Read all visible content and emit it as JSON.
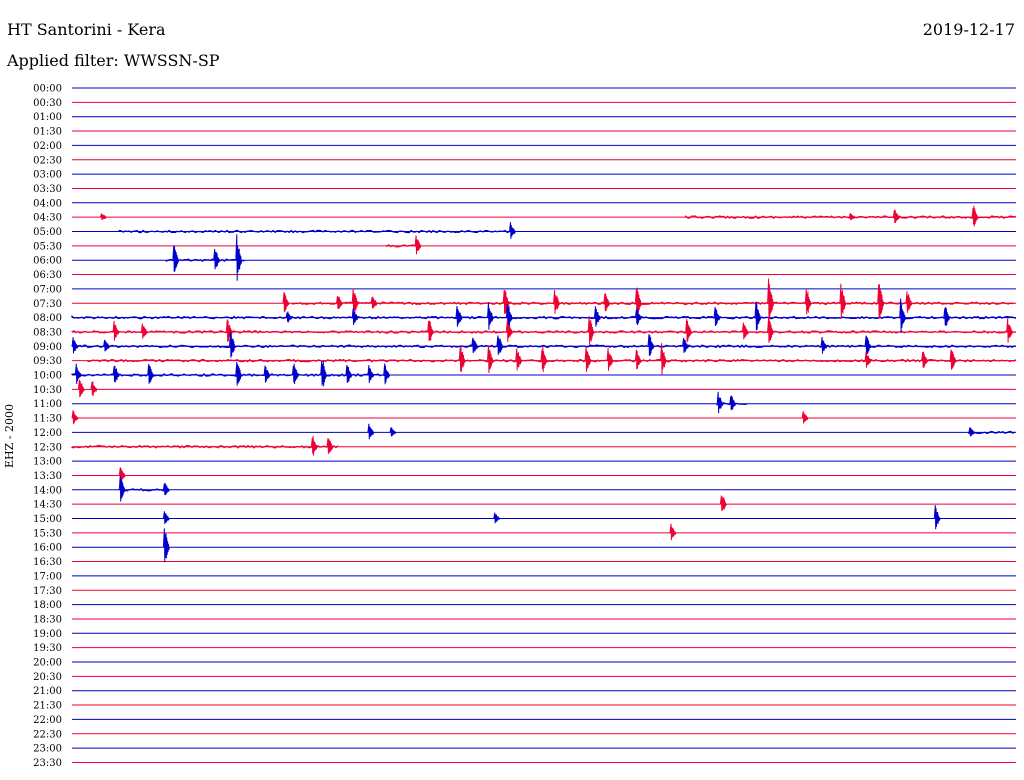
{
  "header": {
    "station": "HT Santorini - Kera",
    "date": "2019-12-17",
    "filter": "Applied filter: WWSSN-SP"
  },
  "chart_data": {
    "type": "line",
    "title": "HT Santorini - Kera",
    "subtitle": "Applied filter: WWSSN-SP",
    "ylabel": "EHZ - 2000",
    "xlabel": "",
    "grid": false,
    "legend": "none",
    "x_range_minutes": [
      0,
      30
    ],
    "colors": {
      "even": "#0000cc",
      "odd": "#ee0033"
    },
    "rows": [
      "00:00",
      "00:30",
      "01:00",
      "01:30",
      "02:00",
      "02:30",
      "03:00",
      "03:30",
      "04:00",
      "04:30",
      "05:00",
      "05:30",
      "06:00",
      "06:30",
      "07:00",
      "07:30",
      "08:00",
      "08:30",
      "09:00",
      "09:30",
      "10:00",
      "10:30",
      "11:00",
      "11:30",
      "12:00",
      "12:30",
      "13:00",
      "13:30",
      "14:00",
      "14:30",
      "15:00",
      "15:30",
      "16:00",
      "16:30",
      "17:00",
      "17:30",
      "18:00",
      "18:30",
      "19:00",
      "19:30",
      "20:00",
      "20:30",
      "21:00",
      "21:30",
      "22:00",
      "22:30",
      "23:00",
      "23:30"
    ],
    "segments": [
      {
        "row": "04:30",
        "start": 19.5,
        "end": 30.0
      },
      {
        "row": "05:00",
        "start": 1.5,
        "end": 14.0
      },
      {
        "row": "05:30",
        "start": 10.0,
        "end": 11.0
      },
      {
        "row": "06:00",
        "start": 3.0,
        "end": 5.5
      },
      {
        "row": "07:30",
        "start": 7.0,
        "end": 30.0
      },
      {
        "row": "08:00",
        "start": 0.0,
        "end": 30.0
      },
      {
        "row": "08:30",
        "start": 0.0,
        "end": 30.0
      },
      {
        "row": "09:00",
        "start": 0.0,
        "end": 30.0
      },
      {
        "row": "09:30",
        "start": 0.5,
        "end": 30.0
      },
      {
        "row": "10:00",
        "start": 0.0,
        "end": 10.0
      },
      {
        "row": "11:00",
        "start": 20.5,
        "end": 21.5
      },
      {
        "row": "12:00",
        "start": 28.5,
        "end": 30.0
      },
      {
        "row": "12:30",
        "start": 0.0,
        "end": 8.5
      },
      {
        "row": "14:00",
        "start": 1.5,
        "end": 3.0
      }
    ],
    "events": [
      {
        "row": "04:30",
        "t": 1.0,
        "amp": 5
      },
      {
        "row": "04:30",
        "t": 24.8,
        "amp": 4
      },
      {
        "row": "04:30",
        "t": 26.2,
        "amp": 10
      },
      {
        "row": "04:30",
        "t": 28.7,
        "amp": 14
      },
      {
        "row": "05:00",
        "t": 14.0,
        "amp": 10
      },
      {
        "row": "05:30",
        "t": 11.0,
        "amp": 12
      },
      {
        "row": "06:00",
        "t": 3.3,
        "amp": 18
      },
      {
        "row": "06:00",
        "t": 4.6,
        "amp": 14
      },
      {
        "row": "06:00",
        "t": 5.3,
        "amp": 26
      },
      {
        "row": "07:30",
        "t": 6.8,
        "amp": 12
      },
      {
        "row": "07:30",
        "t": 8.5,
        "amp": 10
      },
      {
        "row": "07:30",
        "t": 9.0,
        "amp": 16
      },
      {
        "row": "07:30",
        "t": 9.6,
        "amp": 10
      },
      {
        "row": "07:30",
        "t": 13.8,
        "amp": 18
      },
      {
        "row": "07:30",
        "t": 15.4,
        "amp": 16
      },
      {
        "row": "07:30",
        "t": 17.0,
        "amp": 12
      },
      {
        "row": "07:30",
        "t": 18.0,
        "amp": 20
      },
      {
        "row": "07:30",
        "t": 22.2,
        "amp": 26
      },
      {
        "row": "07:30",
        "t": 23.4,
        "amp": 18
      },
      {
        "row": "07:30",
        "t": 24.5,
        "amp": 22
      },
      {
        "row": "07:30",
        "t": 25.7,
        "amp": 26
      },
      {
        "row": "07:30",
        "t": 26.6,
        "amp": 14
      },
      {
        "row": "08:00",
        "t": 6.9,
        "amp": 8
      },
      {
        "row": "08:00",
        "t": 9.0,
        "amp": 10
      },
      {
        "row": "08:00",
        "t": 12.3,
        "amp": 16
      },
      {
        "row": "08:00",
        "t": 13.3,
        "amp": 16
      },
      {
        "row": "08:00",
        "t": 13.9,
        "amp": 18
      },
      {
        "row": "08:00",
        "t": 16.7,
        "amp": 12
      },
      {
        "row": "08:00",
        "t": 18.0,
        "amp": 12
      },
      {
        "row": "08:00",
        "t": 20.5,
        "amp": 12
      },
      {
        "row": "08:00",
        "t": 21.8,
        "amp": 18
      },
      {
        "row": "08:00",
        "t": 26.4,
        "amp": 20
      },
      {
        "row": "08:00",
        "t": 27.8,
        "amp": 14
      },
      {
        "row": "08:30",
        "t": 1.4,
        "amp": 12
      },
      {
        "row": "08:30",
        "t": 2.3,
        "amp": 10
      },
      {
        "row": "08:30",
        "t": 5.0,
        "amp": 14
      },
      {
        "row": "08:30",
        "t": 11.4,
        "amp": 16
      },
      {
        "row": "08:30",
        "t": 13.9,
        "amp": 14
      },
      {
        "row": "08:30",
        "t": 16.5,
        "amp": 18
      },
      {
        "row": "08:30",
        "t": 19.6,
        "amp": 14
      },
      {
        "row": "08:30",
        "t": 21.4,
        "amp": 10
      },
      {
        "row": "08:30",
        "t": 22.2,
        "amp": 16
      },
      {
        "row": "08:30",
        "t": 29.8,
        "amp": 14
      },
      {
        "row": "09:00",
        "t": 0.1,
        "amp": 10
      },
      {
        "row": "09:00",
        "t": 1.1,
        "amp": 10
      },
      {
        "row": "09:00",
        "t": 5.1,
        "amp": 18
      },
      {
        "row": "09:00",
        "t": 12.8,
        "amp": 12
      },
      {
        "row": "09:00",
        "t": 13.6,
        "amp": 16
      },
      {
        "row": "09:00",
        "t": 18.4,
        "amp": 14
      },
      {
        "row": "09:00",
        "t": 19.5,
        "amp": 10
      },
      {
        "row": "09:00",
        "t": 23.9,
        "amp": 10
      },
      {
        "row": "09:00",
        "t": 25.3,
        "amp": 12
      },
      {
        "row": "09:30",
        "t": 12.4,
        "amp": 18
      },
      {
        "row": "09:30",
        "t": 13.3,
        "amp": 16
      },
      {
        "row": "09:30",
        "t": 14.2,
        "amp": 14
      },
      {
        "row": "09:30",
        "t": 15.0,
        "amp": 18
      },
      {
        "row": "09:30",
        "t": 16.4,
        "amp": 16
      },
      {
        "row": "09:30",
        "t": 17.1,
        "amp": 14
      },
      {
        "row": "09:30",
        "t": 18.0,
        "amp": 12
      },
      {
        "row": "09:30",
        "t": 18.8,
        "amp": 18
      },
      {
        "row": "09:30",
        "t": 25.3,
        "amp": 10
      },
      {
        "row": "09:30",
        "t": 27.1,
        "amp": 12
      },
      {
        "row": "09:30",
        "t": 28.0,
        "amp": 14
      },
      {
        "row": "10:00",
        "t": 0.2,
        "amp": 12
      },
      {
        "row": "10:00",
        "t": 1.4,
        "amp": 14
      },
      {
        "row": "10:00",
        "t": 2.5,
        "amp": 14
      },
      {
        "row": "10:00",
        "t": 5.3,
        "amp": 16
      },
      {
        "row": "10:00",
        "t": 6.2,
        "amp": 12
      },
      {
        "row": "10:00",
        "t": 7.1,
        "amp": 14
      },
      {
        "row": "10:00",
        "t": 8.0,
        "amp": 22
      },
      {
        "row": "10:00",
        "t": 8.8,
        "amp": 12
      },
      {
        "row": "10:00",
        "t": 9.5,
        "amp": 10
      },
      {
        "row": "10:00",
        "t": 10.0,
        "amp": 12
      },
      {
        "row": "10:30",
        "t": 0.3,
        "amp": 14
      },
      {
        "row": "10:30",
        "t": 0.7,
        "amp": 10
      },
      {
        "row": "11:00",
        "t": 20.6,
        "amp": 12
      },
      {
        "row": "11:00",
        "t": 21.0,
        "amp": 10
      },
      {
        "row": "11:30",
        "t": 0.1,
        "amp": 8
      },
      {
        "row": "11:30",
        "t": 23.3,
        "amp": 8
      },
      {
        "row": "12:00",
        "t": 9.5,
        "amp": 10
      },
      {
        "row": "12:00",
        "t": 10.2,
        "amp": 6
      },
      {
        "row": "12:00",
        "t": 28.6,
        "amp": 6
      },
      {
        "row": "12:30",
        "t": 7.7,
        "amp": 14
      },
      {
        "row": "12:30",
        "t": 8.2,
        "amp": 12
      },
      {
        "row": "13:30",
        "t": 1.6,
        "amp": 12
      },
      {
        "row": "14:00",
        "t": 1.6,
        "amp": 16
      },
      {
        "row": "14:00",
        "t": 3.0,
        "amp": 8
      },
      {
        "row": "14:30",
        "t": 20.7,
        "amp": 14
      },
      {
        "row": "15:00",
        "t": 3.0,
        "amp": 8
      },
      {
        "row": "15:00",
        "t": 13.5,
        "amp": 6
      },
      {
        "row": "15:00",
        "t": 27.5,
        "amp": 14
      },
      {
        "row": "15:30",
        "t": 19.1,
        "amp": 10
      },
      {
        "row": "16:00",
        "t": 3.0,
        "amp": 22
      }
    ]
  }
}
